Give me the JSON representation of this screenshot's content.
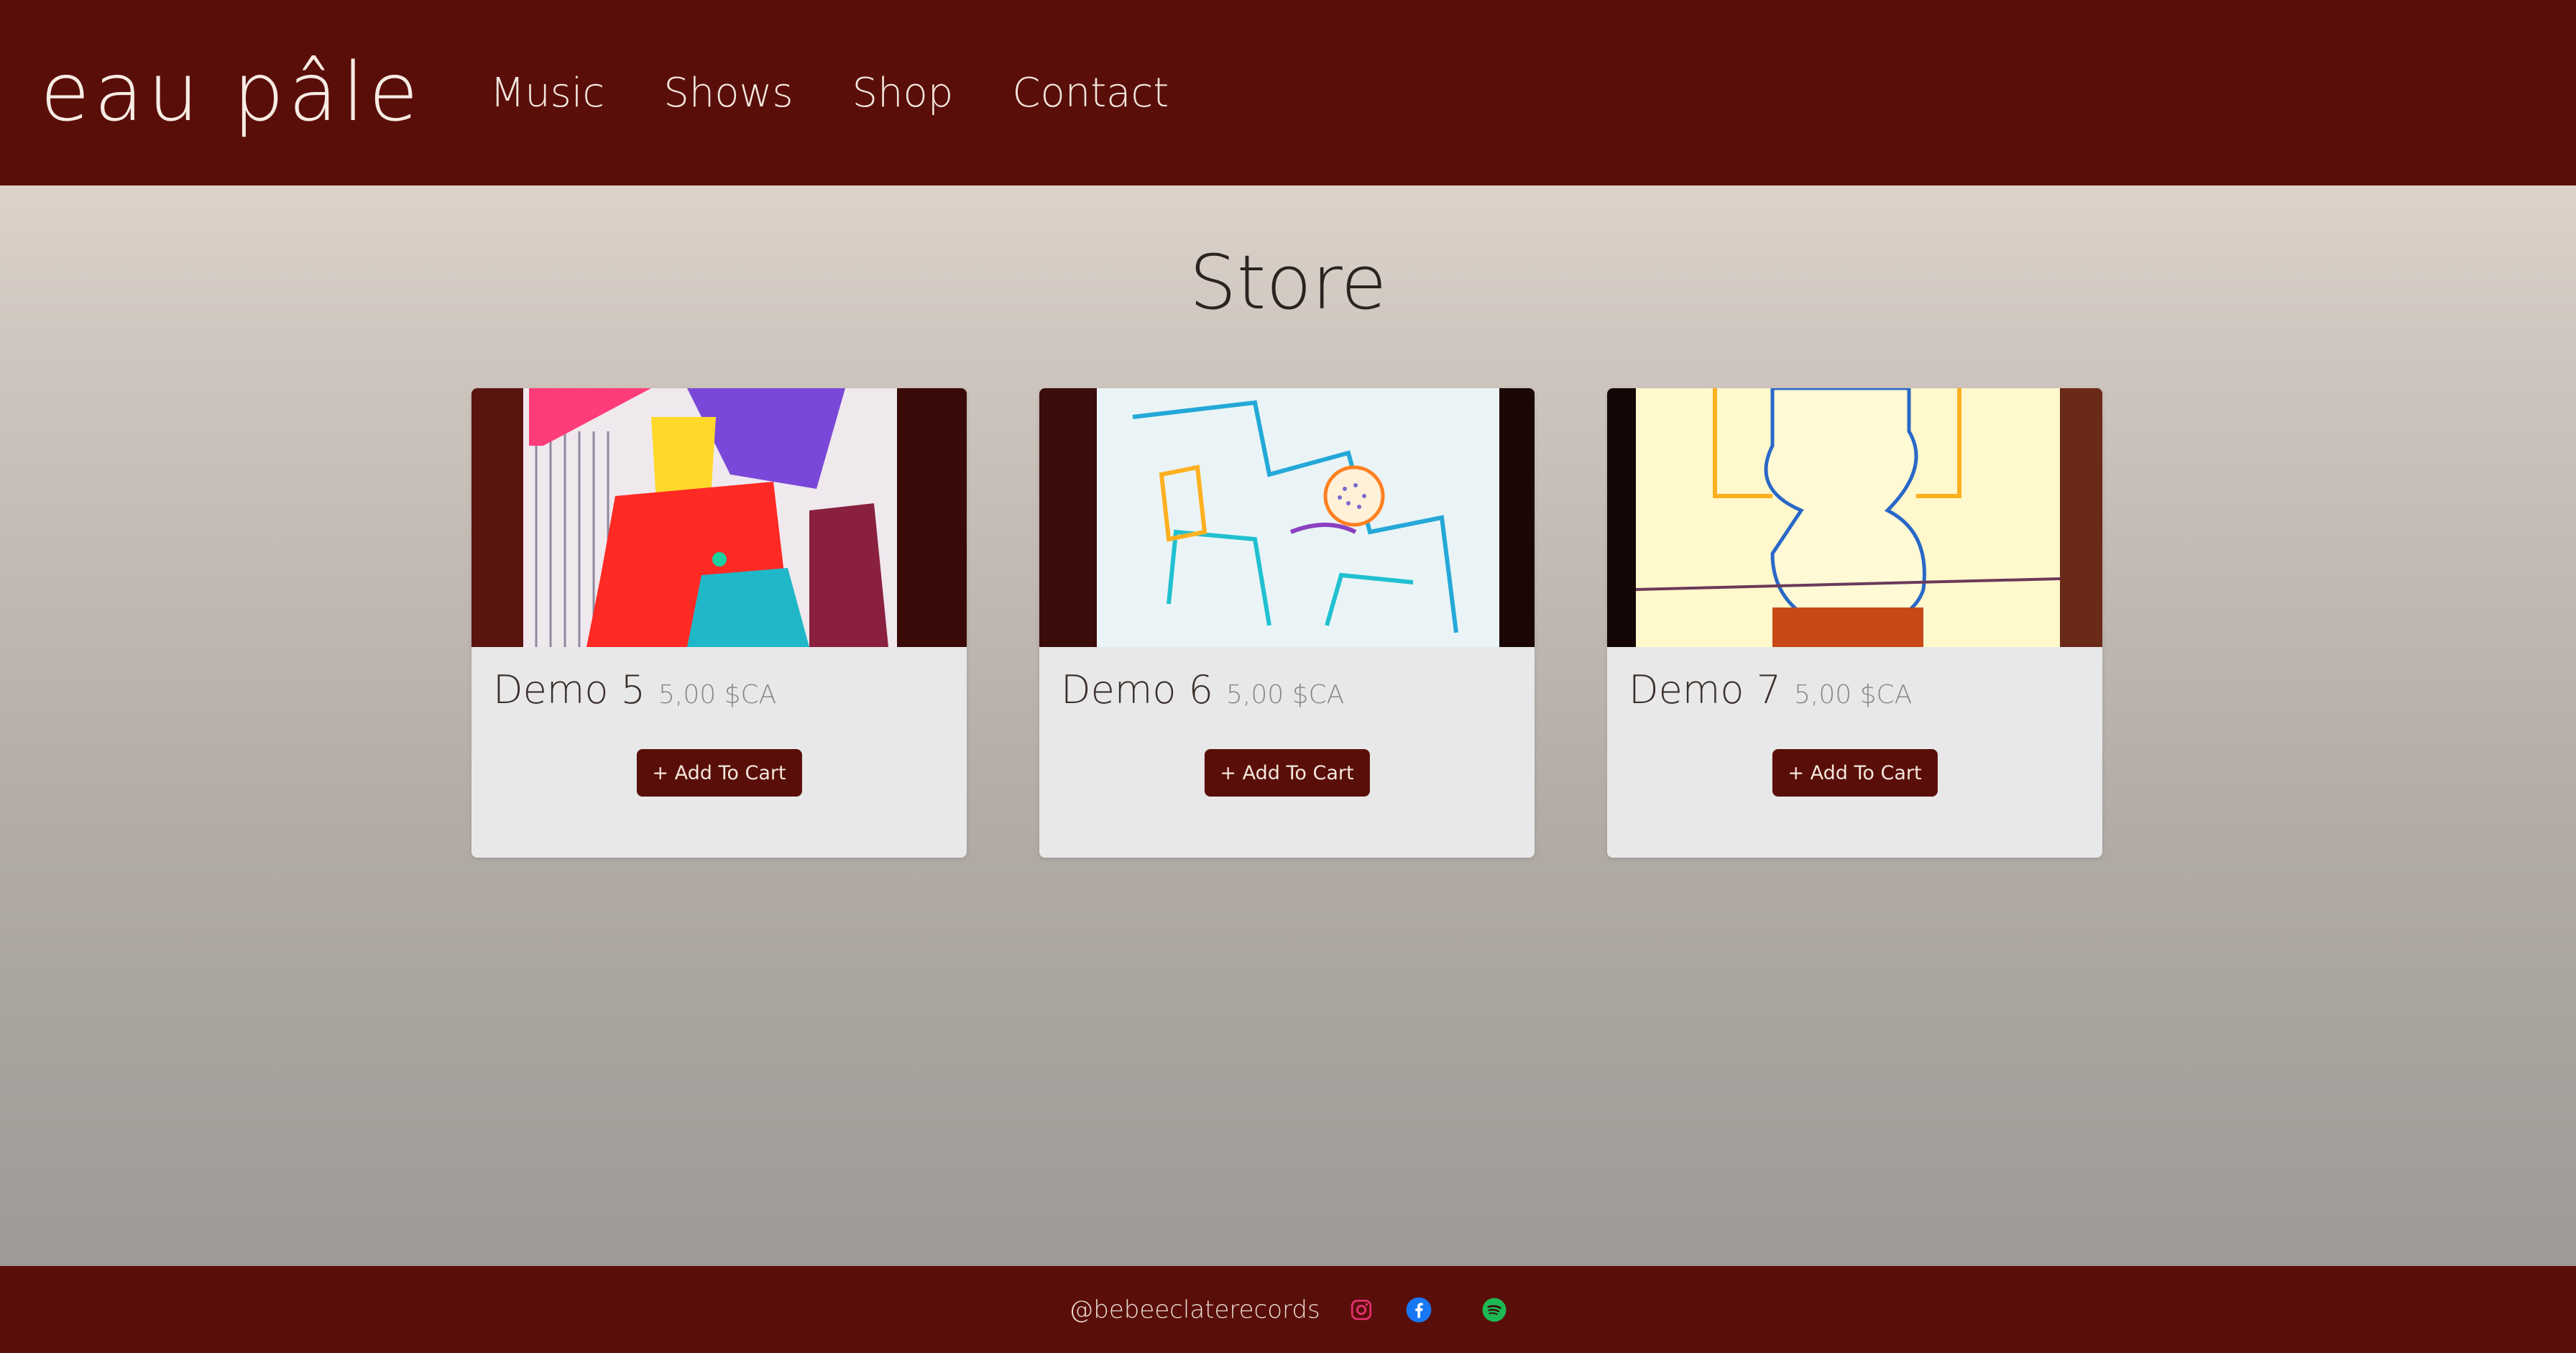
{
  "header": {
    "brand": "eau pâle",
    "nav": [
      "Music",
      "Shows",
      "Shop",
      "Contact"
    ]
  },
  "page": {
    "title": "Store"
  },
  "products": [
    {
      "name": "Demo 5",
      "price": "5,00 $CA",
      "button": "+ Add To Cart"
    },
    {
      "name": "Demo 6",
      "price": "5,00 $CA",
      "button": "+ Add To Cart"
    },
    {
      "name": "Demo 7",
      "price": "5,00 $CA",
      "button": "+ Add To Cart"
    }
  ],
  "footer": {
    "handle": "@bebeeclaterecords",
    "social": [
      "instagram-icon",
      "facebook-icon",
      "spotify-icon"
    ]
  },
  "colors": {
    "brand_dark": "#5a0e09",
    "instagram": "#e1306c",
    "facebook": "#1877f2",
    "spotify": "#1db954"
  }
}
